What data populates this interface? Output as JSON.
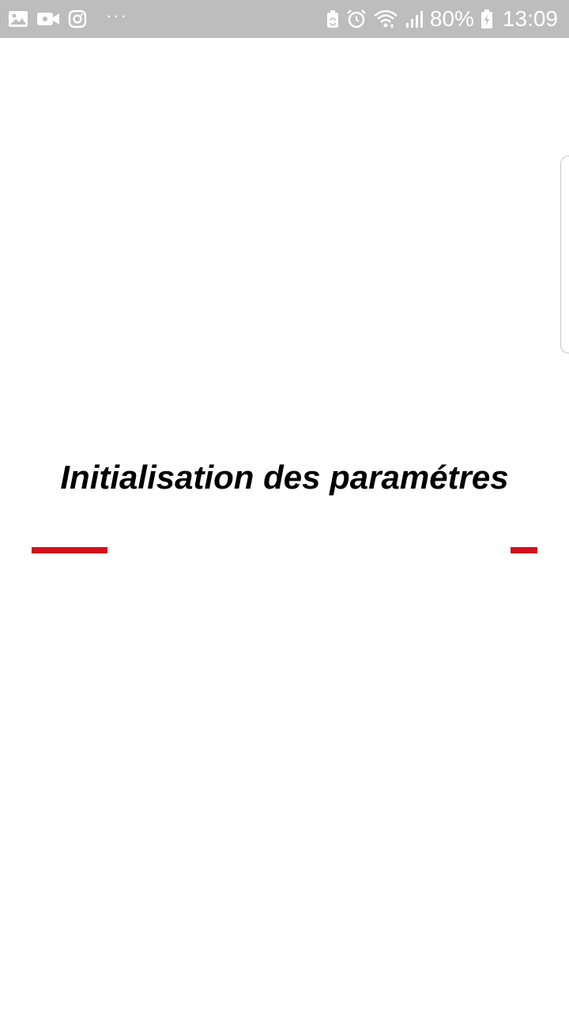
{
  "status_bar": {
    "left_icons": [
      "gallery-icon",
      "video-call-icon",
      "instagram-icon",
      "more-notifications-icon"
    ],
    "right_icons": [
      "battery-saver-icon",
      "alarm-icon",
      "wifi-icon",
      "signal-icon",
      "battery-charging-icon"
    ],
    "battery_percent": "80%",
    "time": "13:09",
    "background_color": "#bdbdbd"
  },
  "main": {
    "title": "Initialisation des paramétres",
    "progress_color": "#d0111b"
  }
}
